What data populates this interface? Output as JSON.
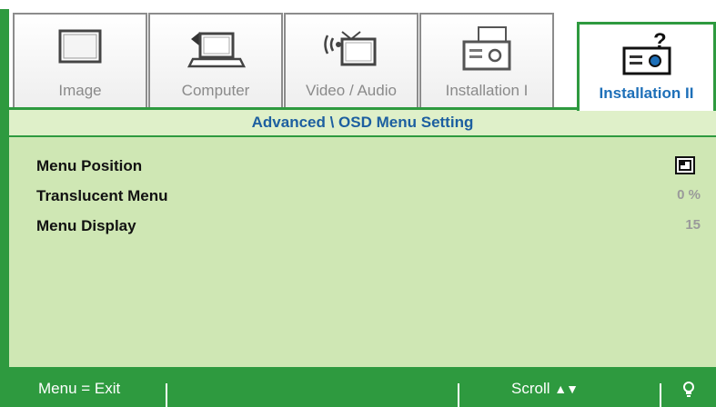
{
  "tabs": [
    {
      "label": "Image",
      "icon": "monitor-icon"
    },
    {
      "label": "Computer",
      "icon": "laptop-icon"
    },
    {
      "label": "Video / Audio",
      "icon": "tv-wireless-icon"
    },
    {
      "label": "Installation I",
      "icon": "projector-icon"
    },
    {
      "label": "Installation II",
      "icon": "projector-help-icon",
      "active": true
    }
  ],
  "panel": {
    "title": "Advanced \\ OSD Menu Setting",
    "rows": [
      {
        "label": "Menu Position",
        "value_icon": "menu-position-icon"
      },
      {
        "label": "Translucent Menu",
        "value": "0 %"
      },
      {
        "label": "Menu Display",
        "value": "15"
      }
    ]
  },
  "statusbar": {
    "exit": "Menu = Exit",
    "scroll": "Scroll",
    "scroll_arrows": "▲▼",
    "tip_icon": "lightbulb-icon"
  },
  "colors": {
    "frame_green": "#2e9a3f",
    "panel_bg": "#cfe7b4",
    "active_label": "#1d6fb8",
    "title_text": "#1d5fa0"
  }
}
